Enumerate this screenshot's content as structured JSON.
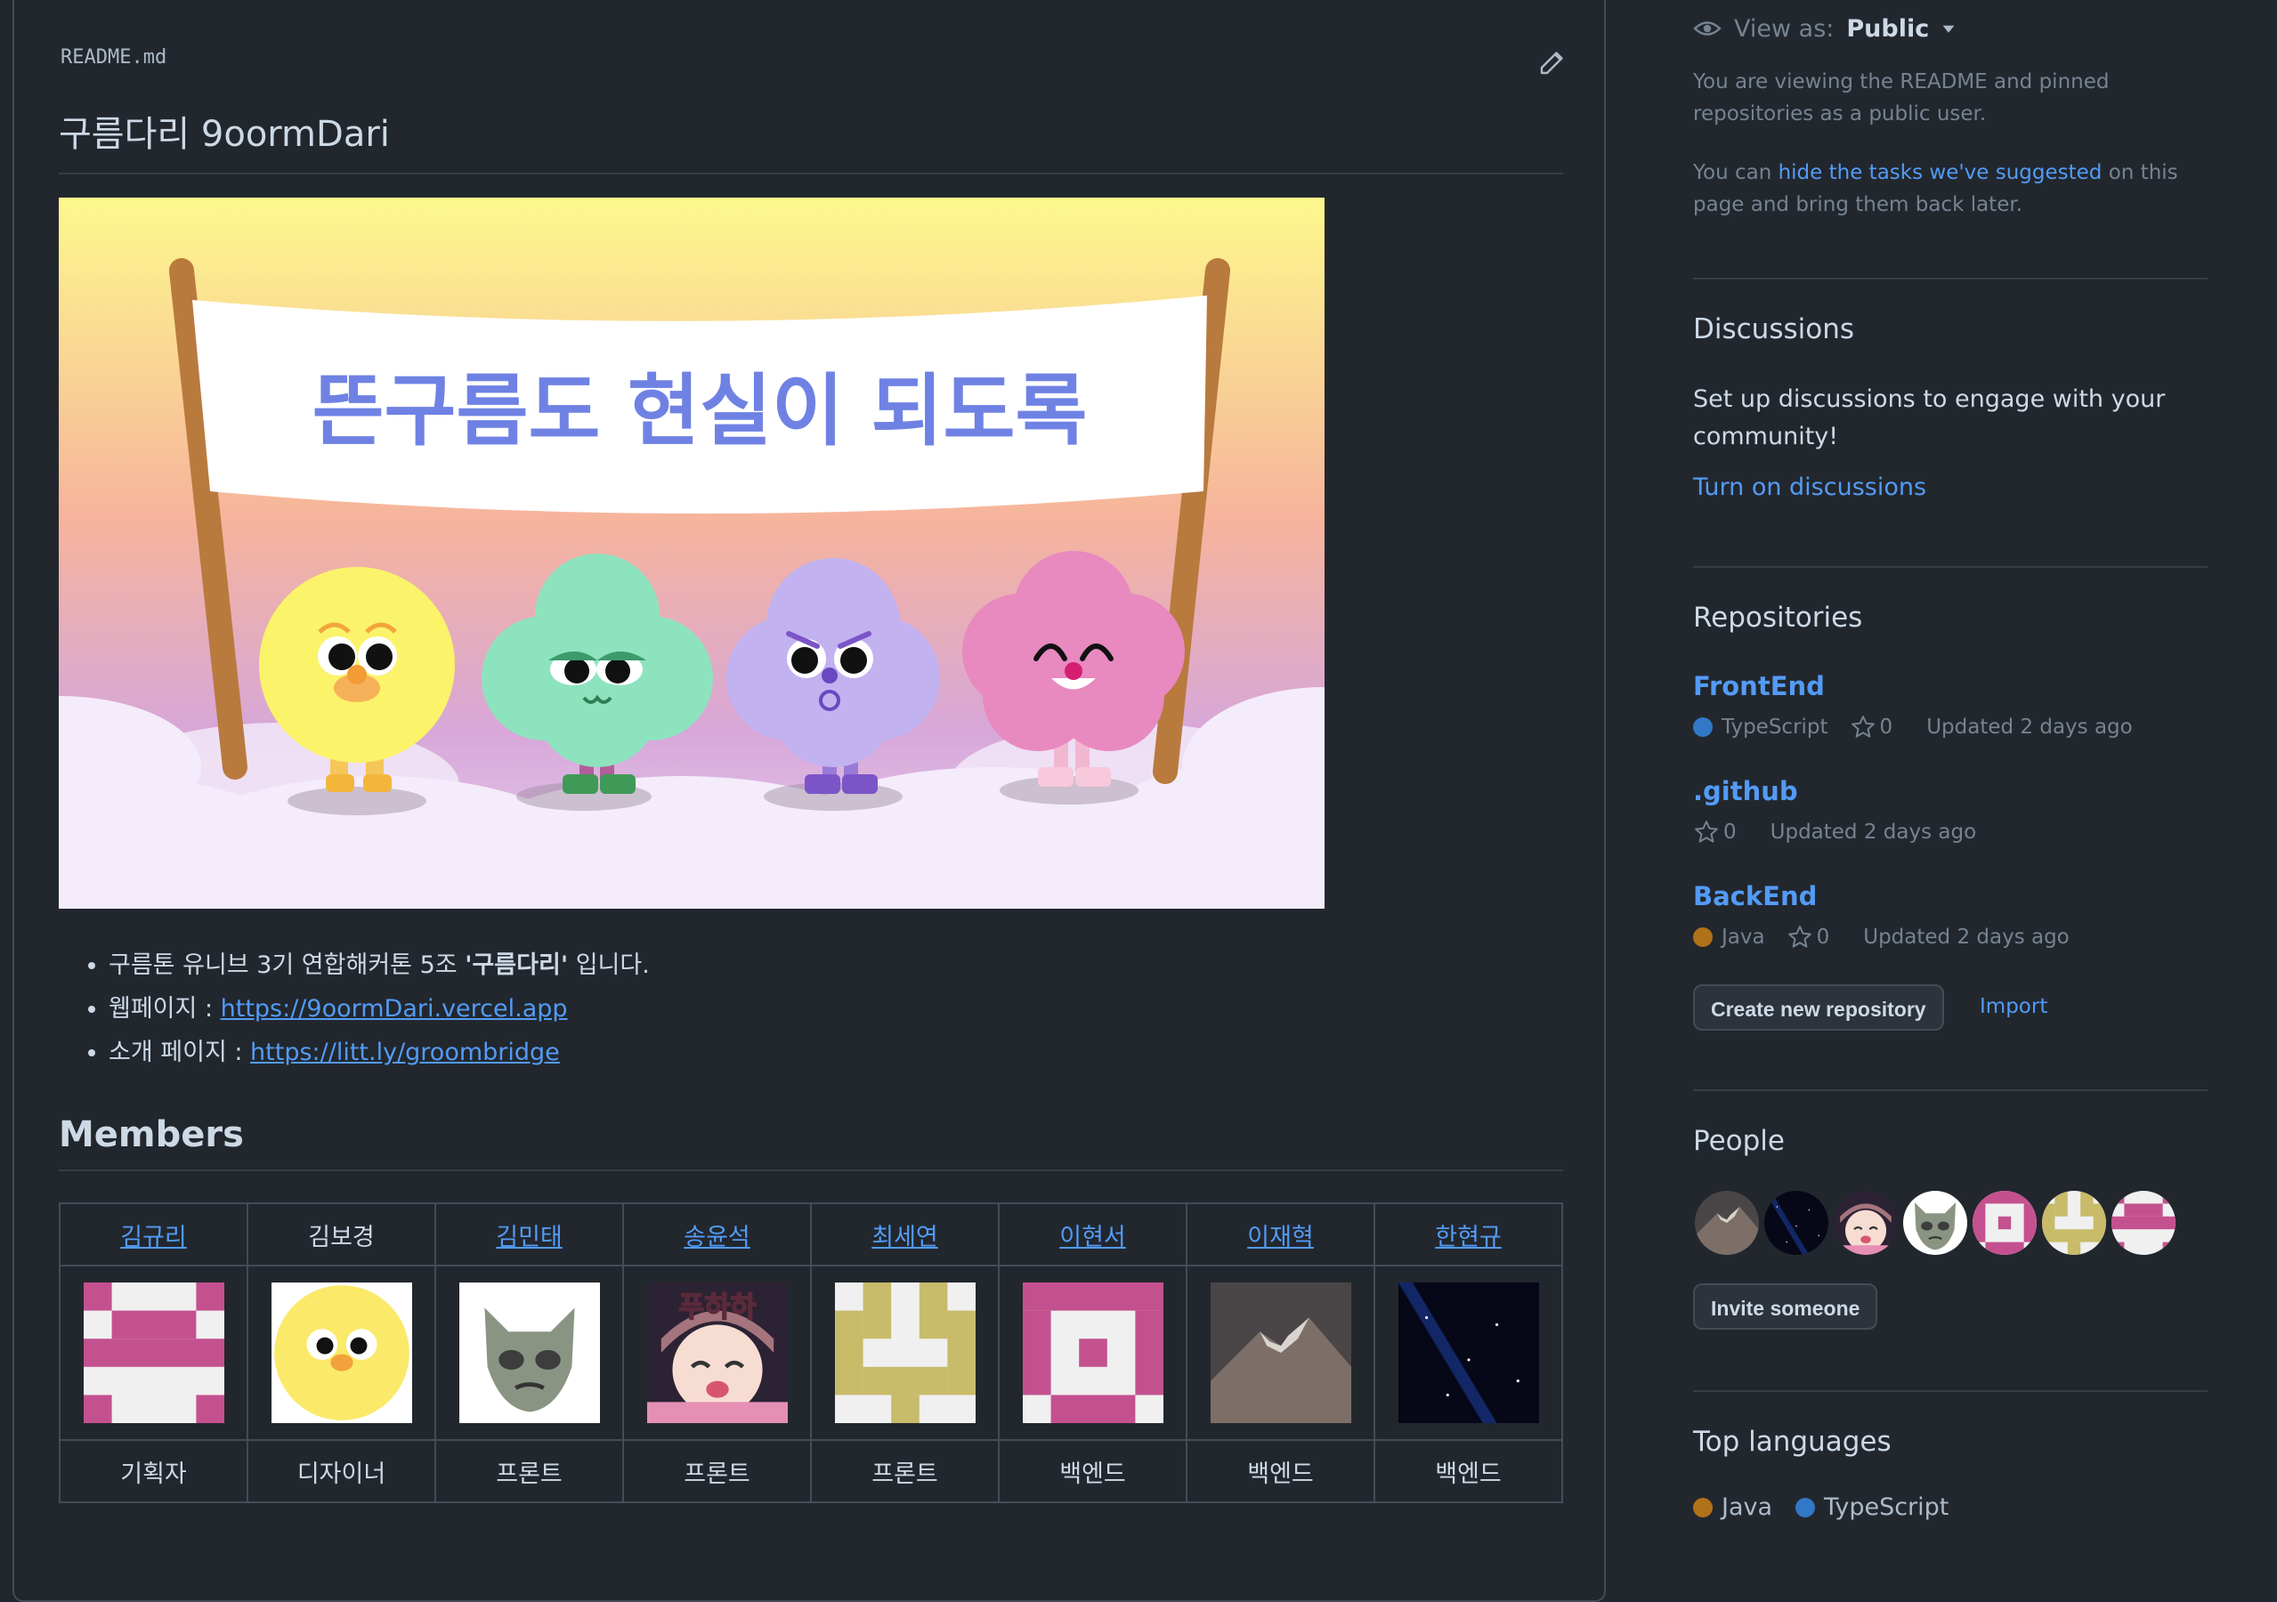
{
  "readme": {
    "filename": "README.md",
    "title": "구름다리 9oormDari",
    "banner_text": "뜬구름도 현실이 되도록",
    "bullets": {
      "b1_pre": "구름톤 유니브 3기 연합해커톤 5조 ",
      "b1_bold": "'구름다리'",
      "b1_post": " 입니다.",
      "b2_label": "웹페이지 : ",
      "b2_link": "https://9oormDari.vercel.app",
      "b3_label": "소개 페이지 : ",
      "b3_link": "https://litt.ly/groombridge"
    },
    "members_heading": "Members",
    "members": [
      {
        "name": "김규리",
        "linked": true,
        "role": "기획자",
        "avatar": "identicon-pink-arch"
      },
      {
        "name": "김보경",
        "linked": false,
        "role": "디자이너",
        "avatar": "yellow-cloud-character"
      },
      {
        "name": "김민태",
        "linked": true,
        "role": "프론트",
        "avatar": "cat-meme"
      },
      {
        "name": "송윤석",
        "linked": true,
        "role": "프론트",
        "avatar": "anime-girl"
      },
      {
        "name": "최세연",
        "linked": true,
        "role": "프론트",
        "avatar": "identicon-olive"
      },
      {
        "name": "이현서",
        "linked": true,
        "role": "백엔드",
        "avatar": "identicon-pink-face"
      },
      {
        "name": "이재혁",
        "linked": true,
        "role": "백엔드",
        "avatar": "mountain-photo"
      },
      {
        "name": "한현규",
        "linked": true,
        "role": "백엔드",
        "avatar": "night-sky-photo"
      }
    ],
    "anime_text": "푸하하"
  },
  "sidebar": {
    "view_as_label": "View as:",
    "view_as_value": "Public",
    "note1": "You are viewing the README and pinned repositories as a public user.",
    "note2_pre": "You can ",
    "note2_link": "hide the tasks we've suggested",
    "note2_post": " on this page and bring them back later.",
    "discussions": {
      "title": "Discussions",
      "text": "Set up discussions to engage with your community!",
      "link": "Turn on discussions"
    },
    "repositories": {
      "title": "Repositories",
      "items": [
        {
          "name": "FrontEnd",
          "language": "TypeScript",
          "lang_color": "#3178c6",
          "stars": "0",
          "updated": "Updated 2 days ago"
        },
        {
          "name": ".github",
          "language": "",
          "lang_color": "",
          "stars": "0",
          "updated": "Updated 2 days ago"
        },
        {
          "name": "BackEnd",
          "language": "Java",
          "lang_color": "#b07219",
          "stars": "0",
          "updated": "Updated 2 days ago"
        }
      ],
      "create_button": "Create new repository",
      "import_link": "Import"
    },
    "people": {
      "title": "People",
      "avatars": [
        "mountain-photo",
        "night-sky-photo",
        "anime-girl",
        "cat-meme",
        "identicon-pink-face",
        "identicon-olive",
        "identicon-pink-arch"
      ],
      "invite_button": "Invite someone"
    },
    "top_languages": {
      "title": "Top languages",
      "items": [
        {
          "name": "Java",
          "color": "#b07219"
        },
        {
          "name": "TypeScript",
          "color": "#3178c6"
        }
      ]
    }
  }
}
